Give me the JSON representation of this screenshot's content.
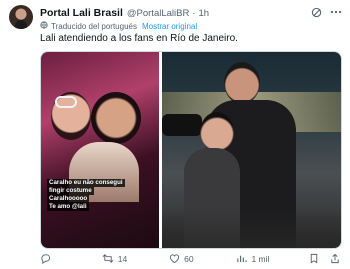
{
  "author": {
    "name": "Portal Lali Brasil",
    "handle": "@PortalLaliBR",
    "time": "1h"
  },
  "translation": {
    "label": "Traducido del portugués",
    "show_original": "Mostrar original"
  },
  "tweet_text": "Lali atendiendo a los fans en Río de Janeiro.",
  "photo_caption": [
    "Caralho eu não consegui",
    "fingir costume",
    "Caralhooooo",
    "Te amo @lali"
  ],
  "actions": {
    "replies": "",
    "reposts": "14",
    "likes": "60",
    "views": "1 mil"
  },
  "colors": {
    "link": "#1d9bf0",
    "muted": "#536471",
    "text": "#0f1419"
  }
}
